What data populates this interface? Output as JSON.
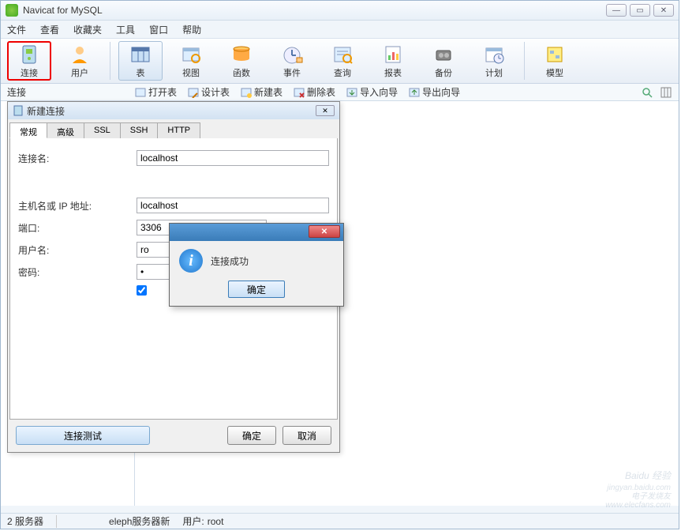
{
  "app": {
    "title": "Navicat for MySQL"
  },
  "menu": {
    "file": "文件",
    "view": "查看",
    "favorites": "收藏夹",
    "tools": "工具",
    "window": "窗口",
    "help": "帮助"
  },
  "toolbar": {
    "connect": "连接",
    "user": "用户",
    "table": "表",
    "view": "视图",
    "function": "函数",
    "event": "事件",
    "query": "查询",
    "report": "报表",
    "backup": "备份",
    "schedule": "计划",
    "model": "模型"
  },
  "secondary": {
    "label": "连接",
    "open_table": "打开表",
    "design_table": "设计表",
    "new_table": "新建表",
    "delete_table": "删除表",
    "import_wizard": "导入向导",
    "export_wizard": "导出向导"
  },
  "dialog": {
    "title": "新建连接",
    "tabs": {
      "general": "常规",
      "advanced": "高级",
      "ssl": "SSL",
      "ssh": "SSH",
      "http": "HTTP"
    },
    "labels": {
      "conn_name": "连接名:",
      "host": "主机名或 IP 地址:",
      "port": "端口:",
      "user": "用户名:",
      "password": "密码:"
    },
    "values": {
      "conn_name": "localhost",
      "host": "localhost",
      "port": "3306",
      "user": "ro",
      "password": "•"
    },
    "buttons": {
      "test": "连接测试",
      "ok": "确定",
      "cancel": "取消"
    }
  },
  "msgbox": {
    "text": "连接成功",
    "ok": "确定"
  },
  "statusbar": {
    "servers": "2 服务器",
    "current": "eleph服务器新",
    "user_label": "用户:",
    "user": "root"
  },
  "watermark": {
    "main": "Baidu 经验",
    "sub1": "jingyan.baidu.com",
    "sub2": "电子发烧友",
    "sub3": "www.elecfans.com"
  }
}
